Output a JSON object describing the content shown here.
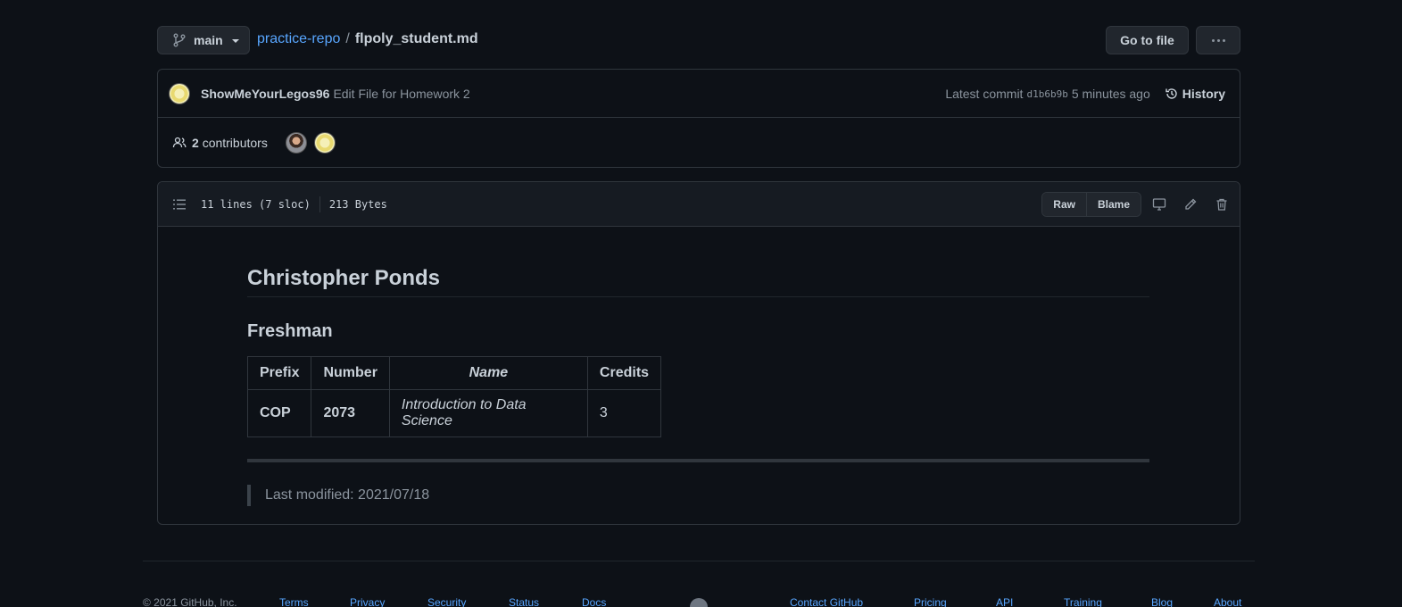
{
  "header": {
    "branch": "main",
    "repo": "practice-repo",
    "separator": "/",
    "file": "flpoly_student.md",
    "go_to_file": "Go to file"
  },
  "commit": {
    "author": "ShowMeYourLegos96",
    "message": "Edit File for Homework 2",
    "latest_label": "Latest commit",
    "sha": "d1b6b9b",
    "time": "5 minutes ago",
    "history": "History"
  },
  "contributors": {
    "count": "2",
    "label": "contributors"
  },
  "file": {
    "lines": "11 lines (7 sloc)",
    "size": "213 Bytes",
    "raw": "Raw",
    "blame": "Blame"
  },
  "markdown": {
    "h1": "Christopher Ponds",
    "h2": "Freshman",
    "table": {
      "headers": [
        "Prefix",
        "Number",
        "Name",
        "Credits"
      ],
      "rows": [
        [
          "COP",
          "2073",
          "Introduction to Data Science",
          "3"
        ]
      ]
    },
    "quote": "Last modified: 2021/07/18"
  },
  "footer": {
    "copyright": "© 2021 GitHub, Inc.",
    "links_left": [
      "Terms",
      "Privacy",
      "Security",
      "Status",
      "Docs"
    ],
    "links_right": [
      "Contact GitHub",
      "Pricing",
      "API",
      "Training",
      "Blog",
      "About"
    ]
  },
  "colors": {
    "background": "#0d1117",
    "link": "#58a6ff",
    "border": "#30363d"
  }
}
